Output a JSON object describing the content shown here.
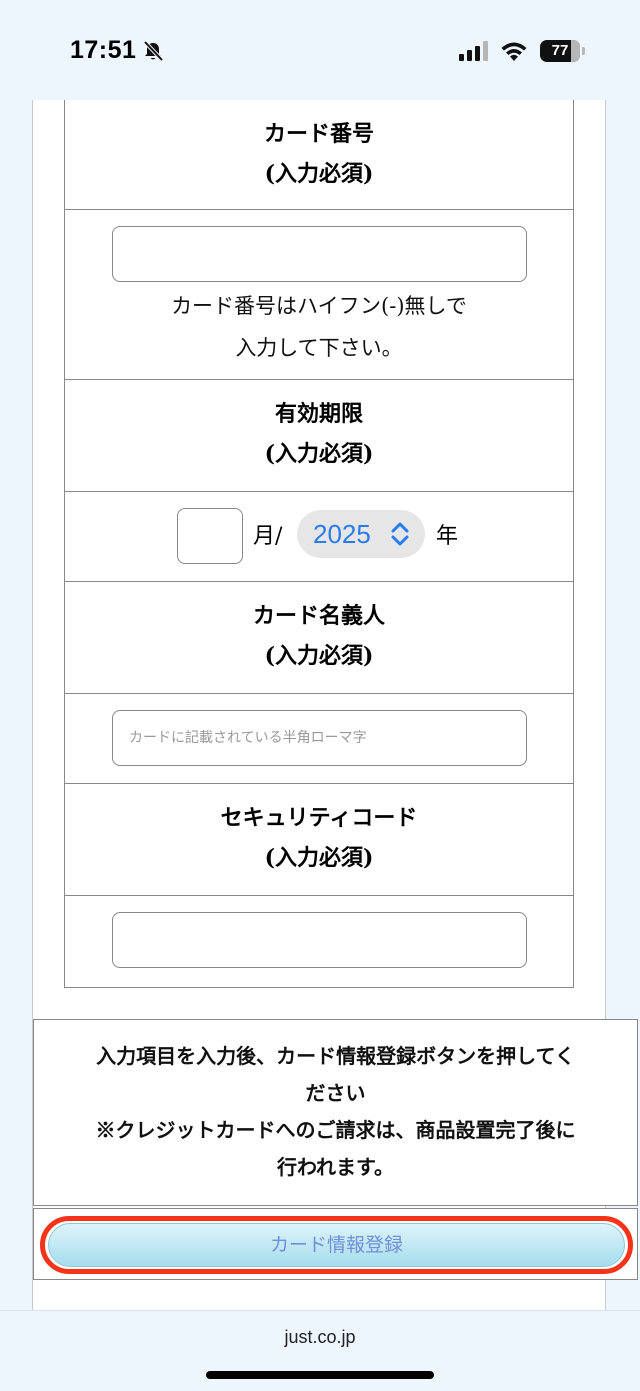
{
  "status_bar": {
    "time": "17:51",
    "battery_level": "77"
  },
  "form": {
    "card_number": {
      "label": "カード番号",
      "required": "(入力必須)",
      "value": "",
      "note_line1": "カード番号はハイフン(-)無しで",
      "note_line2": "入力して下さい。"
    },
    "expiry": {
      "label": "有効期限",
      "required": "(入力必須)",
      "month_value": "",
      "month_suffix": "月/",
      "year_value": "2025",
      "year_suffix": "年"
    },
    "card_holder": {
      "label": "カード名義人",
      "required": "(入力必須)",
      "placeholder": "カードに記載されている半角ローマ字"
    },
    "security_code": {
      "label": "セキュリティコード",
      "required": "(入力必須)",
      "value": ""
    }
  },
  "info": {
    "line1": "入力項目を入力後、カード情報登録ボタンを押してく",
    "line2": "ださい",
    "line3": "※クレジットカードへのご請求は、商品設置完了後に",
    "line4": "行われます。"
  },
  "register_button": {
    "label": "カード情報登録"
  },
  "browser": {
    "url": "just.co.jp"
  },
  "colors": {
    "background": "#eef6fd",
    "select_text": "#2a7bf0",
    "highlight": "#f43318",
    "button_text": "#6f8fd8"
  }
}
